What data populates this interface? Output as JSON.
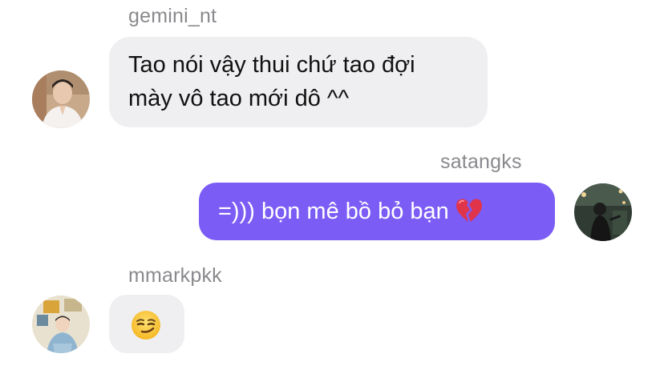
{
  "messages": [
    {
      "sender": "gemini_nt",
      "direction": "incoming",
      "lines": [
        "Tao nói vậy thui chứ tao đợi",
        "mày vô tao mới dô ^^"
      ]
    },
    {
      "sender": "satangks",
      "direction": "outgoing",
      "text": "=))) bọn mê bồ bỏ bạn",
      "emoji": "broken-heart-icon"
    },
    {
      "sender": "mmarkpkk",
      "direction": "incoming",
      "emoji": "smirking-face-icon"
    }
  ],
  "colors": {
    "outgoing_bubble": "#7b5cf5",
    "incoming_bubble": "#efeff1",
    "sender_name": "#8a8a8e"
  }
}
